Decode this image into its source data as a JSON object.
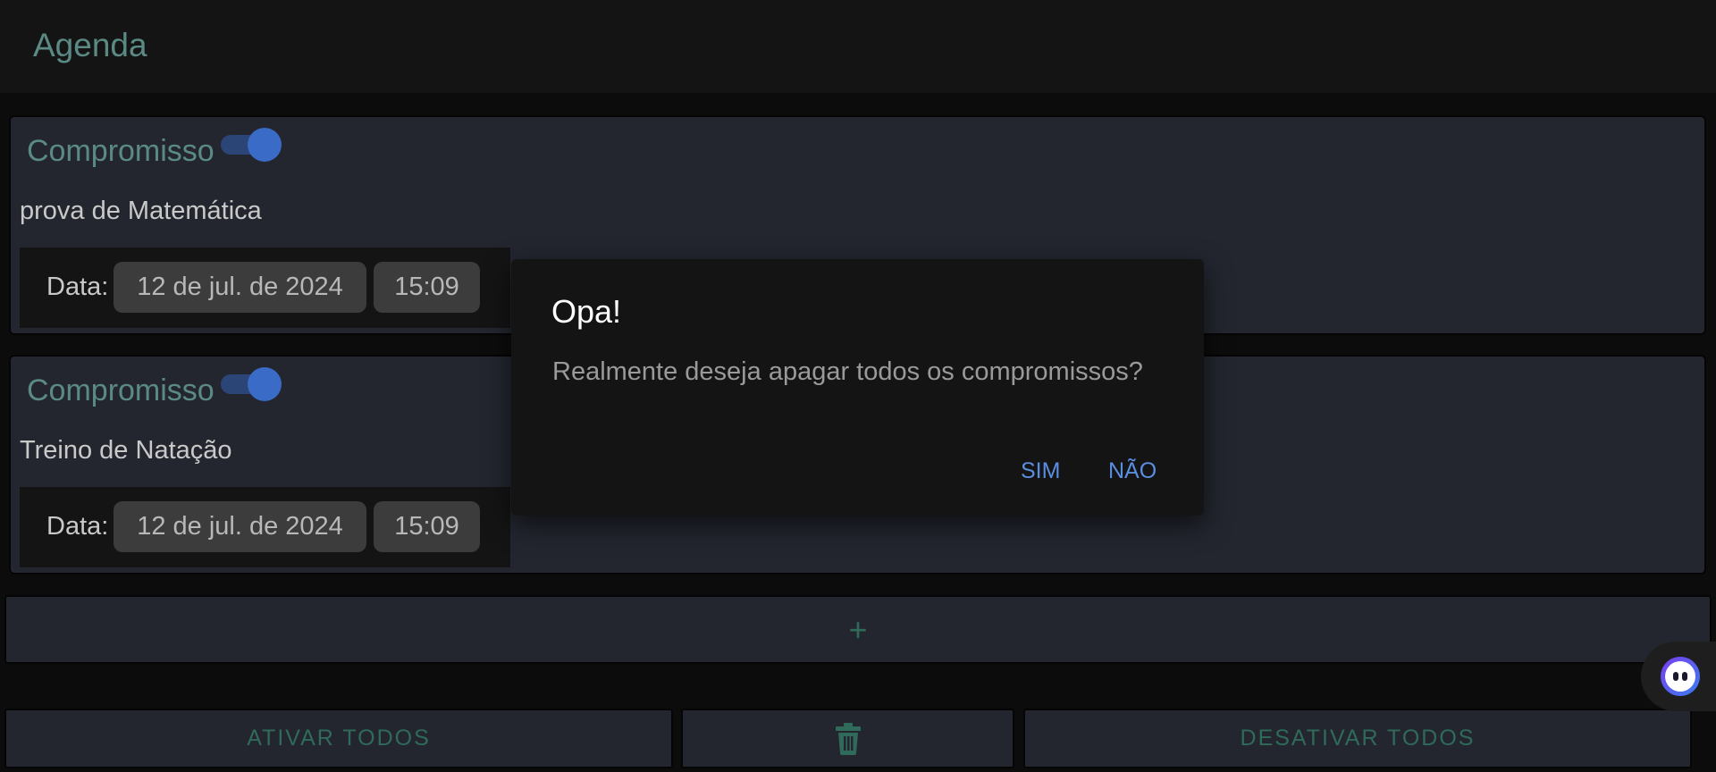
{
  "header": {
    "title": "Agenda"
  },
  "appointments": [
    {
      "title": "Compromisso",
      "enabled": true,
      "description": "prova de Matemática",
      "date_label": "Data:",
      "date": "12 de jul. de 2024",
      "time": "15:09"
    },
    {
      "title": "Compromisso",
      "enabled": true,
      "description": "Treino de Natação",
      "date_label": "Data:",
      "date": "12 de jul. de 2024",
      "time": "15:09"
    }
  ],
  "add_bar": {
    "icon": "plus-icon",
    "label": "+"
  },
  "actions": {
    "activate_all": "ATIVAR TODOS",
    "delete_icon": "trash-icon",
    "deactivate_all": "DESATIVAR TODOS"
  },
  "dialog": {
    "title": "Opa!",
    "message": "Realmente deseja apagar todos os compromissos?",
    "confirm": "SIM",
    "cancel": "NÃO"
  },
  "assistant": {
    "icon": "assistant-bot-icon"
  },
  "colors": {
    "accent_teal": "#5b8a85",
    "button_text": "#2f6a5a",
    "link_blue": "#5a8ee0",
    "toggle_on": "#3a6bc6"
  }
}
